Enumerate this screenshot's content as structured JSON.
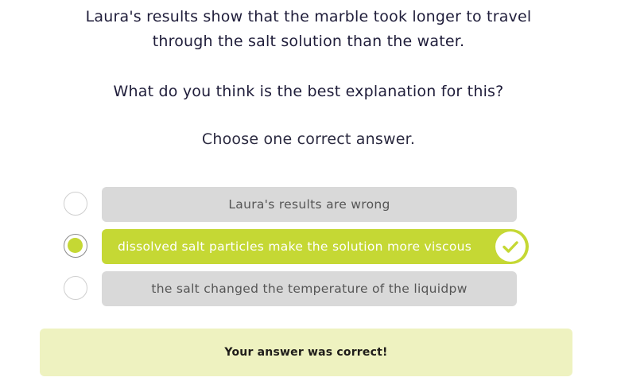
{
  "question": {
    "statement_lines": [
      "Laura's results show that the marble took longer to travel",
      "through the salt solution than the water."
    ],
    "prompt": "What do you think is the best explanation for this?",
    "instruction": "Choose one correct answer."
  },
  "options": [
    {
      "label": "Laura's results are wrong",
      "selected": false,
      "correct": false
    },
    {
      "label": "dissolved salt particles make the solution more viscous",
      "selected": true,
      "correct": true
    },
    {
      "label": "the salt changed the temperature of the liquidpw",
      "selected": false,
      "correct": false
    }
  ],
  "feedback": {
    "message": "Your answer was correct!"
  },
  "icons": {
    "selected_marker": "check-icon"
  },
  "colors": {
    "accent": "#c5d834",
    "option_bg": "#d9d9d9",
    "feedback_bg": "#eef2c0",
    "text": "#1f1d3a"
  }
}
